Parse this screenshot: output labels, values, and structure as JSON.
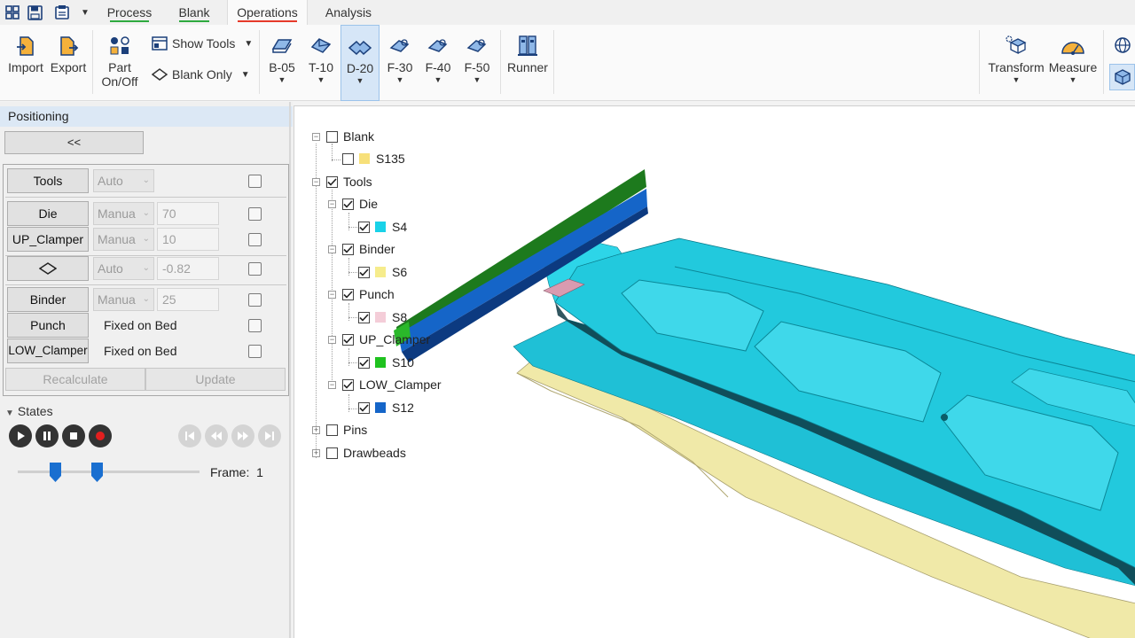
{
  "tabs": [
    {
      "label": "Process",
      "underline": "#2eaa3f"
    },
    {
      "label": "Blank",
      "underline": "#2eaa3f"
    },
    {
      "label": "Operations",
      "underline": "#e63a2a"
    },
    {
      "label": "Analysis",
      "underline": ""
    }
  ],
  "ribbon": {
    "import": "Import",
    "export": "Export",
    "part_onoff_1": "Part",
    "part_onoff_2": "On/Off",
    "show_tools": "Show Tools",
    "blank_only": "Blank Only",
    "ops": [
      "B-05",
      "T-10",
      "D-20",
      "F-30",
      "F-40",
      "F-50"
    ],
    "runner": "Runner",
    "transform": "Transform",
    "measure": "Measure"
  },
  "panel": {
    "title": "Positioning",
    "collapse": "<<",
    "rows": {
      "tools": {
        "label": "Tools",
        "mode": "Auto"
      },
      "die": {
        "label": "Die",
        "mode": "Manua",
        "value": "70"
      },
      "up_clamper": {
        "label": "UP_Clamper",
        "mode": "Manua",
        "value": "10"
      },
      "blank": {
        "mode": "Auto",
        "value": "-0.82"
      },
      "binder": {
        "label": "Binder",
        "mode": "Manua",
        "value": "25"
      },
      "punch": {
        "label": "Punch",
        "status": "Fixed on Bed"
      },
      "low_clamper": {
        "label": "LOW_Clamper",
        "status": "Fixed on Bed"
      }
    },
    "recalculate": "Recalculate",
    "update": "Update",
    "states_title": "States",
    "frame_label": "Frame:",
    "frame_value": "1"
  },
  "tree": {
    "blank": "Blank",
    "s135": "S135",
    "tools": "Tools",
    "die": "Die",
    "s4": "S4",
    "binder": "Binder",
    "s6": "S6",
    "punch": "Punch",
    "s8": "S8",
    "up_clamper": "UP_Clamper",
    "s10": "S10",
    "low_clamper": "LOW_Clamper",
    "s12": "S12",
    "pins": "Pins",
    "drawbeads": "Drawbeads"
  },
  "colors": {
    "s135": "#f7e07a",
    "s4": "#19d2e8",
    "s6": "#f6ec8c",
    "s8": "#f4cdd8",
    "s10": "#1fc21f",
    "s12": "#1565c8",
    "die_surface": "#22c9dd",
    "blank_sheet": "#f0e9a8",
    "accent": "#1a6fd0"
  }
}
